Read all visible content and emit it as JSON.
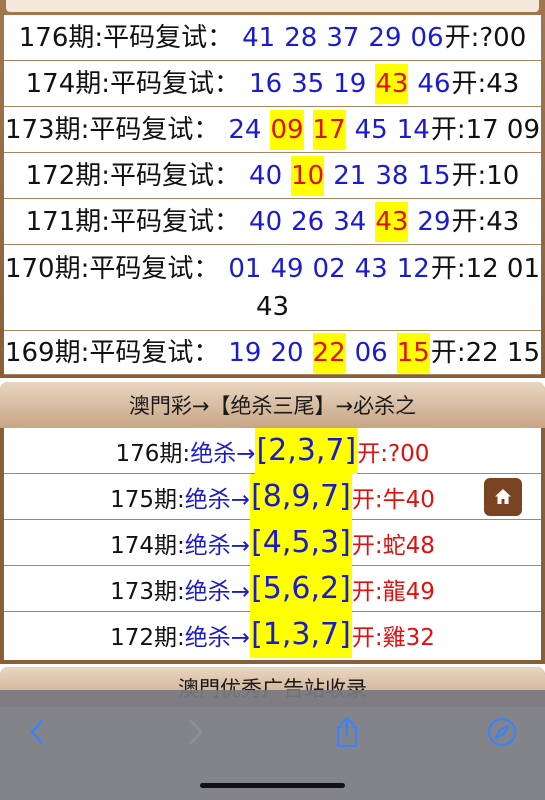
{
  "pingma": {
    "rows": [
      {
        "label": "176期:平码复试：",
        "nums": [
          {
            "v": "41",
            "hl": false
          },
          {
            "v": "28",
            "hl": false
          },
          {
            "v": "37",
            "hl": false
          },
          {
            "v": "29",
            "hl": false
          },
          {
            "v": "06",
            "hl": false
          }
        ],
        "result": "开:?00",
        "result_line2": ""
      },
      {
        "label": "174期:平码复试：",
        "nums": [
          {
            "v": "16",
            "hl": false
          },
          {
            "v": "35",
            "hl": false
          },
          {
            "v": "19",
            "hl": false
          },
          {
            "v": "43",
            "hl": true
          },
          {
            "v": "46",
            "hl": false
          }
        ],
        "result": "开:43",
        "result_line2": ""
      },
      {
        "label": "173期:平码复试：",
        "nums": [
          {
            "v": "24",
            "hl": false
          },
          {
            "v": "09",
            "hl": true
          },
          {
            "v": "17",
            "hl": true
          },
          {
            "v": "45",
            "hl": false
          },
          {
            "v": "14",
            "hl": false
          }
        ],
        "result": "开:17 09",
        "result_line2": ""
      },
      {
        "label": "172期:平码复试：",
        "nums": [
          {
            "v": "40",
            "hl": false
          },
          {
            "v": "10",
            "hl": true
          },
          {
            "v": "21",
            "hl": false
          },
          {
            "v": "38",
            "hl": false
          },
          {
            "v": "15",
            "hl": false
          }
        ],
        "result": "开:10",
        "result_line2": ""
      },
      {
        "label": "171期:平码复试：",
        "nums": [
          {
            "v": "40",
            "hl": false
          },
          {
            "v": "26",
            "hl": false
          },
          {
            "v": "34",
            "hl": false
          },
          {
            "v": "43",
            "hl": true
          },
          {
            "v": "29",
            "hl": false
          }
        ],
        "result": "开:43",
        "result_line2": ""
      },
      {
        "label": "170期:平码复试：",
        "nums": [
          {
            "v": "01",
            "hl": false
          },
          {
            "v": "49",
            "hl": false
          },
          {
            "v": "02",
            "hl": false
          },
          {
            "v": "43",
            "hl": false
          },
          {
            "v": "12",
            "hl": false
          }
        ],
        "result": "开:12 01",
        "result_line2": "43"
      },
      {
        "label": "169期:平码复试：",
        "nums": [
          {
            "v": "19",
            "hl": false
          },
          {
            "v": "20",
            "hl": false
          },
          {
            "v": "22",
            "hl": true
          },
          {
            "v": "06",
            "hl": false
          },
          {
            "v": "15",
            "hl": true
          }
        ],
        "result": "开:22 15",
        "result_line2": ""
      }
    ]
  },
  "juesha": {
    "title": "澳門彩→【绝杀三尾】→必杀之",
    "rows": [
      {
        "period": "176期:",
        "kill": "绝杀→",
        "set": "[2,3,7]",
        "result": "开:?00"
      },
      {
        "period": "175期:",
        "kill": "绝杀→",
        "set": "[8,9,7]",
        "result": "开:牛40"
      },
      {
        "period": "174期:",
        "kill": "绝杀→",
        "set": "[4,5,3]",
        "result": "开:蛇48"
      },
      {
        "period": "173期:",
        "kill": "绝杀→",
        "set": "[5,6,2]",
        "result": "开:龍49"
      },
      {
        "period": "172期:",
        "kill": "绝杀→",
        "set": "[1,3,7]",
        "result": "开:雞32"
      }
    ]
  },
  "next_section": {
    "title": "澳門优秀广告站收录"
  },
  "colors": {
    "blue": "#1a1ad0",
    "red": "#e01010",
    "highlight": "#ffff00",
    "frame": "#8a5f38",
    "accent": "#3b82f6"
  },
  "icons": {
    "home": "home-icon",
    "back": "chevron-left-icon",
    "forward": "chevron-right-icon",
    "share": "share-icon",
    "compass": "compass-icon"
  }
}
